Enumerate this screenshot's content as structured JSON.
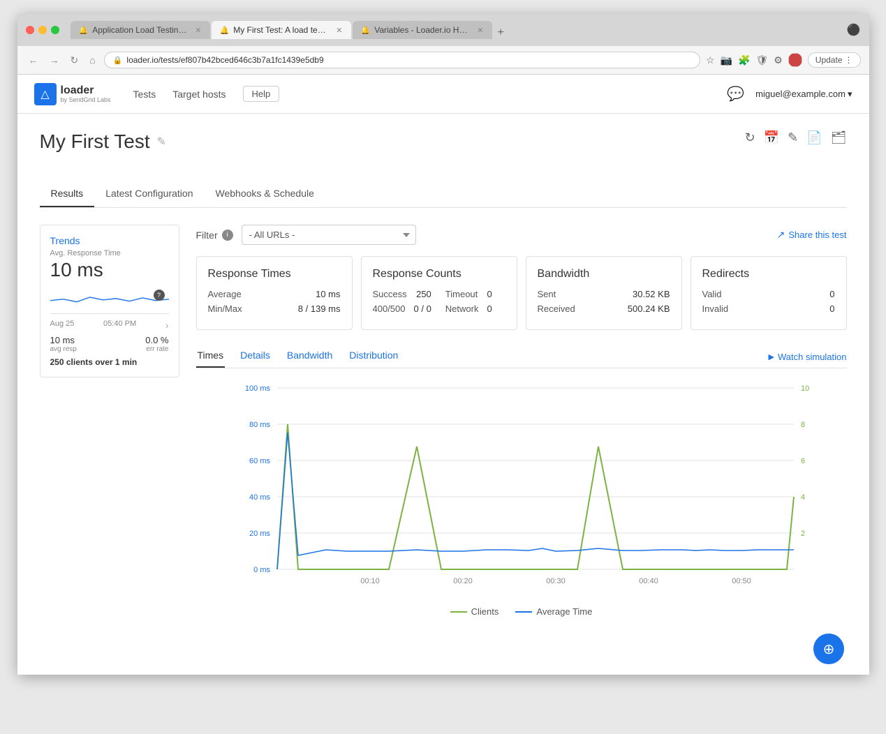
{
  "browser": {
    "tabs": [
      {
        "label": "Application Load Testing Tools",
        "active": false,
        "icon": "🔔"
      },
      {
        "label": "My First Test: A load test by lo...",
        "active": true,
        "icon": "🔔"
      },
      {
        "label": "Variables - Loader.io Help Des...",
        "active": false,
        "icon": "🔔"
      }
    ],
    "url": "loader.io/tests/ef807b42bced646c3b7a1fc1439e5db9",
    "update_btn": "Update"
  },
  "header": {
    "logo_name": "loader",
    "logo_sub": "by SendGrid Labs",
    "nav": [
      "Tests",
      "Target hosts",
      "Help"
    ],
    "user": "miguel@example.com"
  },
  "page": {
    "title": "My First Test",
    "action_icons": [
      "refresh",
      "calendar",
      "edit",
      "copy",
      "folder"
    ]
  },
  "tabs": [
    {
      "label": "Results",
      "active": true
    },
    {
      "label": "Latest Configuration",
      "active": false
    },
    {
      "label": "Webhooks & Schedule",
      "active": false
    }
  ],
  "trends": {
    "title": "Trends",
    "subtitle": "Avg. Response Time",
    "value": "10 ms",
    "date": "Aug 25",
    "time": "05:40 PM",
    "avg_resp": "10 ms",
    "avg_resp_label": "avg resp",
    "err_rate": "0.0 %",
    "err_rate_label": "err rate",
    "clients_text": "250 clients over",
    "duration": "1 min"
  },
  "filter": {
    "label": "Filter",
    "select_value": "- All URLs -",
    "select_options": [
      "- All URLs -"
    ]
  },
  "share": {
    "label": "Share this test"
  },
  "response_times": {
    "title": "Response Times",
    "average_label": "Average",
    "average_value": "10 ms",
    "minmax_label": "Min/Max",
    "minmax_value": "8 / 139 ms"
  },
  "response_counts": {
    "title": "Response Counts",
    "success_label": "Success",
    "success_value": "250",
    "timeout_label": "Timeout",
    "timeout_value": "0",
    "status_label": "400/500",
    "status_value": "0 / 0",
    "network_label": "Network",
    "network_value": "0"
  },
  "bandwidth": {
    "title": "Bandwidth",
    "sent_label": "Sent",
    "sent_value": "30.52 KB",
    "received_label": "Received",
    "received_value": "500.24 KB"
  },
  "redirects": {
    "title": "Redirects",
    "valid_label": "Valid",
    "valid_value": "0",
    "invalid_label": "Invalid",
    "invalid_value": "0"
  },
  "subtabs": [
    {
      "label": "Times",
      "active": true
    },
    {
      "label": "Details",
      "active": false
    },
    {
      "label": "Bandwidth",
      "active": false
    },
    {
      "label": "Distribution",
      "active": false
    }
  ],
  "watch_simulation": "Watch simulation",
  "chart": {
    "y_labels_left": [
      "100 ms",
      "80 ms",
      "60 ms",
      "40 ms",
      "20 ms",
      "0 ms"
    ],
    "y_labels_right": [
      "10",
      "8",
      "6",
      "4",
      "2"
    ],
    "x_labels": [
      "00:10",
      "00:20",
      "00:30",
      "00:40",
      "00:50"
    ],
    "legend_clients": "Clients",
    "legend_avg_time": "Average Time"
  }
}
